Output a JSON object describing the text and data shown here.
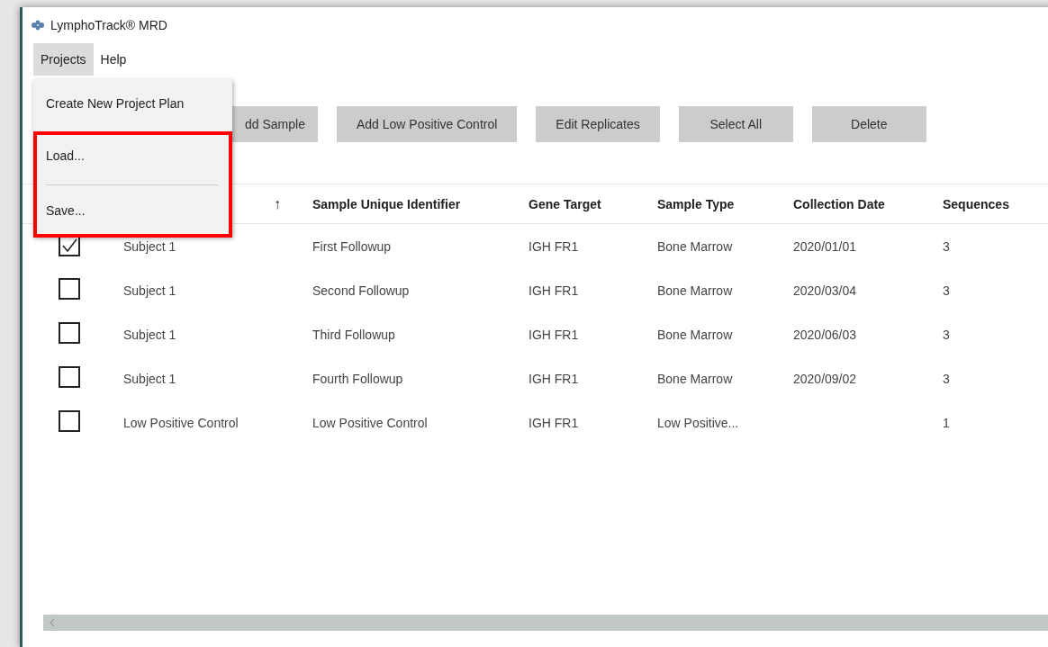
{
  "window": {
    "title": "LymphoTrack® MRD"
  },
  "menu_bar": [
    {
      "label": "Projects",
      "selected": true
    },
    {
      "label": "Help",
      "selected": false
    }
  ],
  "dropdown": {
    "items": [
      {
        "kind": "item",
        "label": "Create New Project Plan"
      },
      {
        "kind": "item",
        "label": "Load..."
      },
      {
        "kind": "separator"
      },
      {
        "kind": "item",
        "label": "Save..."
      }
    ],
    "highlighted": true
  },
  "toolbar": [
    "dd Sample",
    "Add Low Positive Control",
    "Edit Replicates",
    "Select All",
    "Delete"
  ],
  "table": {
    "sort_indicator": "↑",
    "columns": [
      "Sample Unique Identifier",
      "Gene Target",
      "Sample Type",
      "Collection Date",
      "Sequences"
    ],
    "rows": [
      {
        "checked": true,
        "column_2": "Subject 1",
        "cells": [
          "First Followup",
          "IGH FR1",
          "Bone Marrow",
          "2020/01/01",
          "3"
        ]
      },
      {
        "checked": false,
        "column_2": "Subject 1",
        "cells": [
          "Second Followup",
          "IGH FR1",
          "Bone Marrow",
          "2020/03/04",
          "3"
        ]
      },
      {
        "checked": false,
        "column_2": "Subject 1",
        "cells": [
          "Third Followup",
          "IGH FR1",
          "Bone Marrow",
          "2020/06/03",
          "3"
        ]
      },
      {
        "checked": false,
        "column_2": "Subject 1",
        "cells": [
          "Fourth Followup",
          "IGH FR1",
          "Bone Marrow",
          "2020/09/02",
          "3"
        ]
      },
      {
        "checked": false,
        "column_2": "Low Positive Control",
        "cells": [
          "Low Positive Control",
          "IGH FR1",
          "Low Positive...",
          null,
          "1"
        ]
      }
    ]
  }
}
